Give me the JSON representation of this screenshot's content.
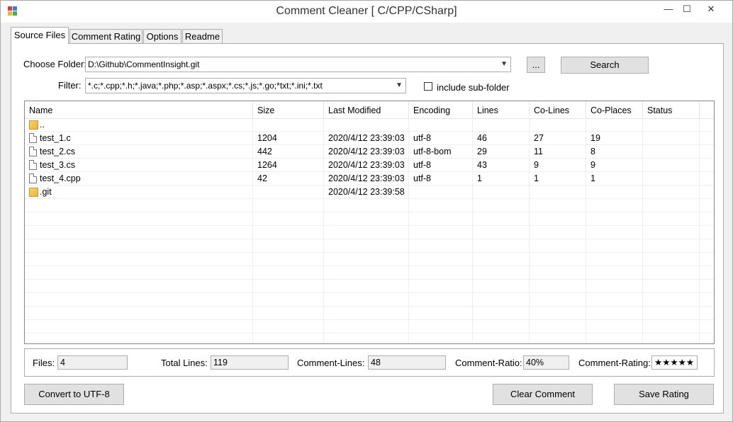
{
  "window": {
    "title": "Comment Cleaner [ C/CPP/CSharp]",
    "minimize_glyph": "—",
    "maximize_glyph": "☐",
    "close_glyph": "✕"
  },
  "tabs": [
    {
      "label": "Source Files",
      "active": true
    },
    {
      "label": "Comment Rating"
    },
    {
      "label": "Options"
    },
    {
      "label": "Readme"
    }
  ],
  "folder": {
    "label": "Choose Folder:",
    "value": "D:\\Github\\CommentInsight.git",
    "browse_label": "...",
    "search_label": "Search"
  },
  "filter": {
    "label": "Filter:",
    "value": "*.c;*.cpp;*.h;*.java;*.php;*.asp;*.aspx;*.cs;*.js;*.go;*txt;*.ini;*.txt",
    "subfolder_label": "include sub-folder",
    "subfolder_checked": false
  },
  "table": {
    "columns": [
      "Name",
      "Size",
      "Last Modified",
      "Encoding",
      "Lines",
      "Co-Lines",
      "Co-Places",
      "Status"
    ],
    "rows": [
      {
        "icon": "folder-icon",
        "name": "..",
        "size": "",
        "modified": "",
        "encoding": "",
        "lines": "",
        "co_lines": "",
        "co_places": "",
        "status": ""
      },
      {
        "icon": "file-icon",
        "name": "test_1.c",
        "size": "1204",
        "modified": "2020/4/12 23:39:03",
        "encoding": "utf-8",
        "lines": "46",
        "co_lines": "27",
        "co_places": "19",
        "status": ""
      },
      {
        "icon": "file-icon",
        "name": "test_2.cs",
        "size": "442",
        "modified": "2020/4/12 23:39:03",
        "encoding": "utf-8-bom",
        "lines": "29",
        "co_lines": "11",
        "co_places": "8",
        "status": ""
      },
      {
        "icon": "file-icon",
        "name": "test_3.cs",
        "size": "1264",
        "modified": "2020/4/12 23:39:03",
        "encoding": "utf-8",
        "lines": "43",
        "co_lines": "9",
        "co_places": "9",
        "status": ""
      },
      {
        "icon": "file-icon",
        "name": "test_4.cpp",
        "size": "42",
        "modified": "2020/4/12 23:39:03",
        "encoding": "utf-8",
        "lines": "1",
        "co_lines": "1",
        "co_places": "1",
        "status": ""
      },
      {
        "icon": "folder-icon",
        "name": ".git",
        "size": "",
        "modified": "2020/4/12 23:39:58",
        "encoding": "",
        "lines": "",
        "co_lines": "",
        "co_places": "",
        "status": ""
      }
    ]
  },
  "summary": {
    "files_label": "Files:",
    "files_value": "4",
    "total_lines_label": "Total Lines:",
    "total_lines_value": "119",
    "comment_lines_label": "Comment-Lines:",
    "comment_lines_value": "48",
    "comment_ratio_label": "Comment-Ratio:",
    "comment_ratio_value": "40%",
    "comment_rating_label": "Comment-Rating:",
    "comment_rating_value": "★★★★★"
  },
  "actions": {
    "convert_label": "Convert to UTF-8",
    "clear_label": "Clear Comment",
    "save_label": "Save Rating"
  },
  "colors": {
    "window_bg": "#f0f0f0",
    "panel_bg": "#ffffff",
    "border": "#adadad",
    "button_bg": "#e1e1e1",
    "folder_icon": "#e9b53a"
  }
}
